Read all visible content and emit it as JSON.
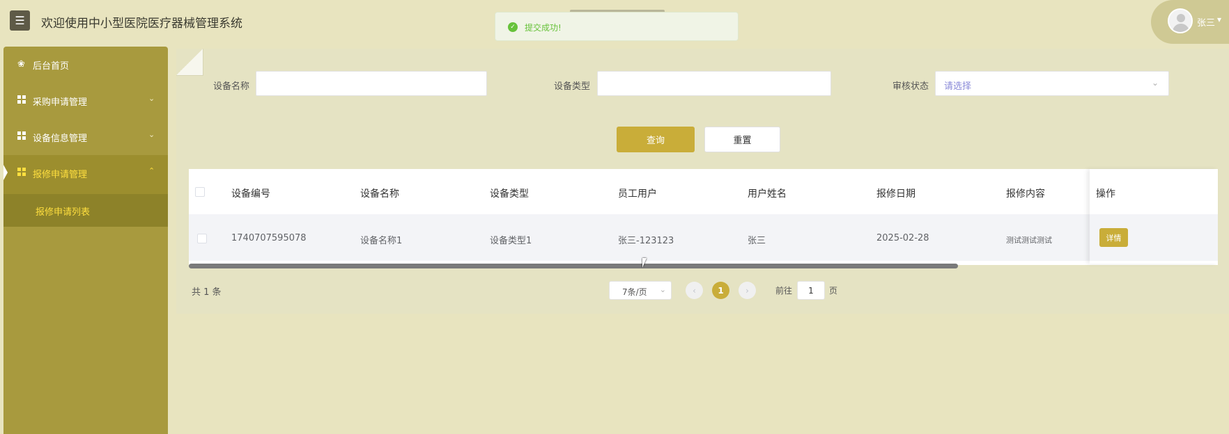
{
  "header": {
    "title": "欢迎使用中小型医院医疗器械管理系统",
    "menu_icon": "hamburger-icon",
    "user_name": "张三"
  },
  "toast": {
    "message": "提交成功!",
    "type": "success",
    "color": "#67c23a"
  },
  "sidebar": {
    "items": [
      {
        "label": "后台首页",
        "icon": "home-icon"
      },
      {
        "label": "采购申请管理",
        "icon": "grid-icon"
      },
      {
        "label": "设备信息管理",
        "icon": "grid-icon"
      },
      {
        "label": "报修申请管理",
        "icon": "grid-icon",
        "expanded": true
      }
    ],
    "sub_items": [
      {
        "label": "报修申请列表",
        "active": true
      }
    ]
  },
  "search": {
    "name_label": "设备名称",
    "name_value": "",
    "type_label": "设备类型",
    "type_value": "",
    "status_label": "审核状态",
    "status_placeholder": "请选择",
    "query_button": "查询",
    "reset_button": "重置"
  },
  "table": {
    "columns": [
      "设备编号",
      "设备名称",
      "设备类型",
      "员工用户",
      "用户姓名",
      "报修日期",
      "报修内容",
      "操作"
    ],
    "rows": [
      {
        "code": "1740707595078",
        "name": "设备名称1",
        "type": "设备类型1",
        "employee": "张三-123123",
        "user_name": "张三",
        "date": "2025-02-28",
        "content": "测试测试测试",
        "action": "详情"
      }
    ]
  },
  "pagination": {
    "total_text": "共 1 条",
    "page_size": "7条/页",
    "current_page": "1",
    "prev_icon": "chevron-left-icon",
    "next_icon": "chevron-right-icon",
    "goto_label": "前往",
    "goto_value": "1",
    "goto_suffix": "页"
  },
  "colors": {
    "accent": "#c9ad39",
    "sidebar": "#a89a3e",
    "background": "#e8e4bf",
    "active_text": "#ffdf3f"
  }
}
